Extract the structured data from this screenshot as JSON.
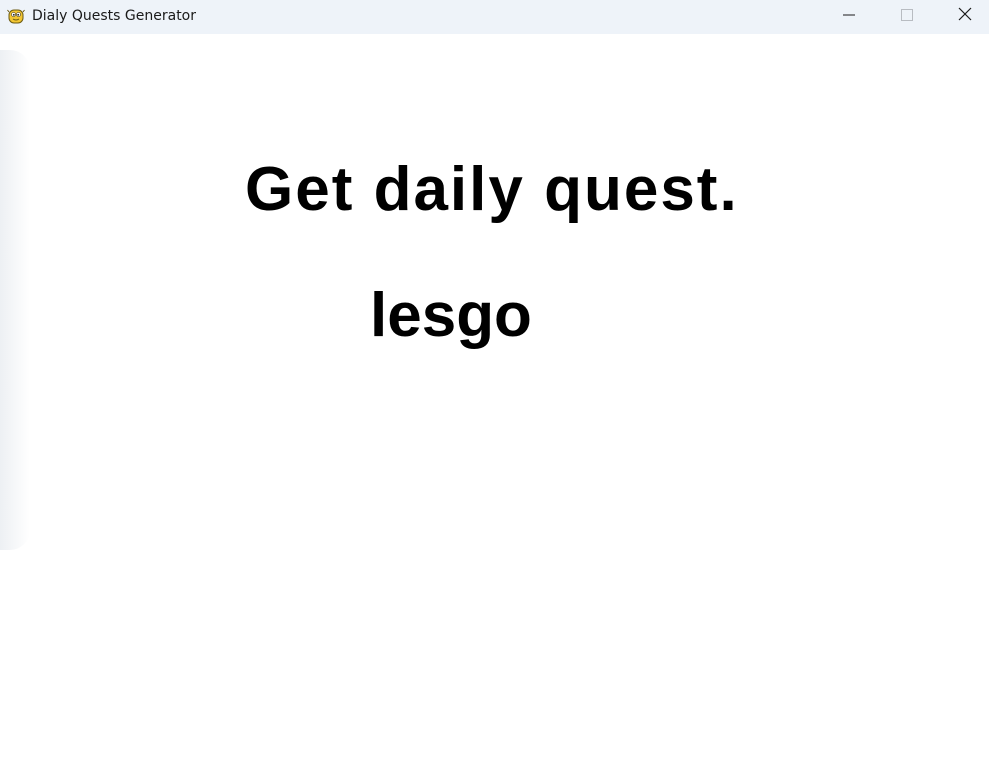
{
  "window": {
    "title": "Dialy Quests Generator",
    "icon": "python-snake-icon"
  },
  "controls": {
    "minimize_icon": "minimize-icon",
    "maximize_icon": "maximize-icon",
    "close_icon": "close-icon"
  },
  "main": {
    "heading": "Get daily quest.",
    "action_label": "lesgo"
  },
  "colors": {
    "titlebar_bg": "#eef3f9",
    "content_bg": "#ffffff",
    "text": "#000000"
  }
}
